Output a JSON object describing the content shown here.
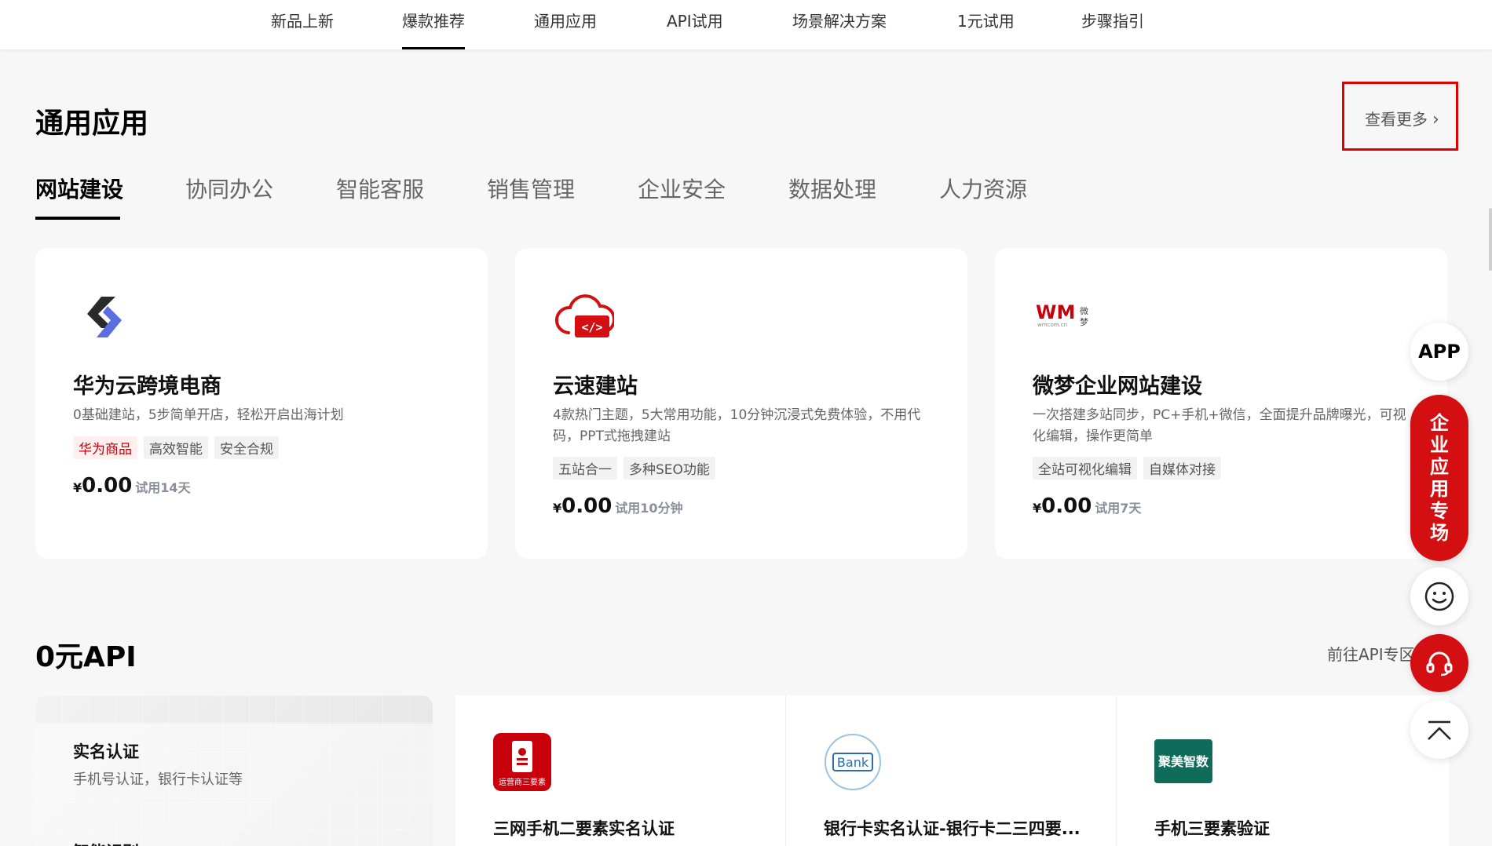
{
  "topnav": {
    "items": [
      "新品上新",
      "爆款推荐",
      "通用应用",
      "API试用",
      "场景解决方案",
      "1元试用",
      "步骤指引"
    ],
    "active_index": 1
  },
  "section": {
    "title": "通用应用",
    "more_label": "查看更多"
  },
  "tabs": [
    "网站建设",
    "协同办公",
    "智能客服",
    "销售管理",
    "企业安全",
    "数据处理",
    "人力资源"
  ],
  "cards": [
    {
      "logo": "huawei-cloud-s-logo",
      "name": "华为云跨境电商",
      "desc": "0基础建站，5步简单开店，轻松开启出海计划",
      "tags": [
        "华为商品",
        "高效智能",
        "安全合规"
      ],
      "currency": "¥",
      "price": "0.00",
      "trial": "试用14天"
    },
    {
      "logo": "cloud-code-logo",
      "name": "云速建站",
      "desc": "4款热门主题，5大常用功能，10分钟沉浸式免费体验，不用代码，PPT式拖拽建站",
      "tags": [
        "五站合一",
        "多种SEO功能"
      ],
      "currency": "¥",
      "price": "0.00",
      "trial": "试用10分钟"
    },
    {
      "logo": "wm-weimeng-logo",
      "name": "微梦企业网站建设",
      "desc": "一次搭建多站同步，PC+手机+微信，全面提升品牌曝光，可视化编辑，操作更简单",
      "tags": [
        "全站可视化编辑",
        "自媒体对接"
      ],
      "currency": "¥",
      "price": "0.00",
      "trial": "试用7天"
    }
  ],
  "api_section": {
    "title": "0元API",
    "more_label": "前往API专区",
    "left": {
      "title": "实名认证",
      "subtitle": "手机号认证，银行卡认证等",
      "next_title": "智能识别"
    },
    "items": [
      {
        "icon": "operator-three-factor-icon",
        "icon_text": "运营商三要素",
        "name": "三网手机二要素实名认证"
      },
      {
        "icon": "bank-icon",
        "icon_text": "Bank",
        "name": "银行卡实名认证-银行卡二三四要..."
      },
      {
        "icon": "jumei-zhishu-icon",
        "icon_text": "聚美智数",
        "name": "手机三要素验证"
      }
    ]
  },
  "float": {
    "app_label": "APP",
    "promo_label": [
      "企",
      "业",
      "应",
      "用",
      "专",
      "场"
    ]
  },
  "colors": {
    "brand_red": "#d40f12",
    "highlight_box": "#e00000"
  }
}
